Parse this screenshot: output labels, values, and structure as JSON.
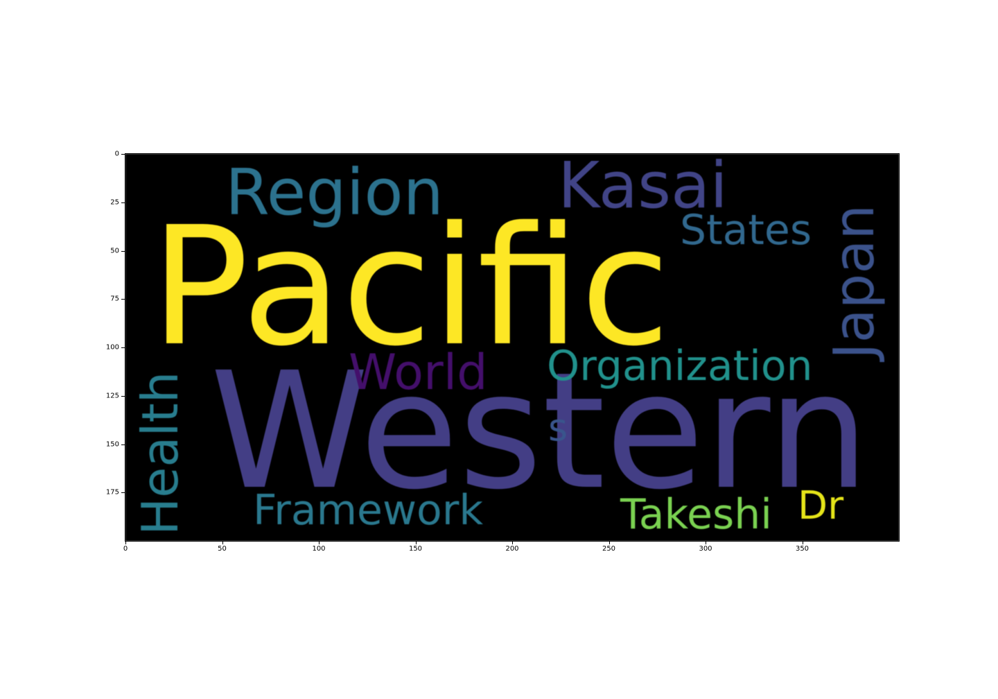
{
  "words": [
    {
      "text": "Pacific",
      "color": "#fde725"
    },
    {
      "text": "Western",
      "color": "#433e85"
    },
    {
      "text": "Region",
      "color": "#2c728e"
    },
    {
      "text": "Kasai",
      "color": "#414487"
    },
    {
      "text": "States",
      "color": "#31688e"
    },
    {
      "text": "Japan",
      "color": "#3b528b"
    },
    {
      "text": "World",
      "color": "#440f6b"
    },
    {
      "text": "Organization",
      "color": "#21918c"
    },
    {
      "text": "Health",
      "color": "#287d8e"
    },
    {
      "text": "s",
      "color": "#39558c"
    },
    {
      "text": "Framework",
      "color": "#2a788e"
    },
    {
      "text": "Takeshi",
      "color": "#7ad151"
    },
    {
      "text": "Dr",
      "color": "#e5e419"
    }
  ],
  "axes": {
    "x_ticks": [
      "0",
      "50",
      "100",
      "150",
      "200",
      "250",
      "300",
      "350"
    ],
    "y_ticks": [
      "0",
      "25",
      "50",
      "75",
      "100",
      "125",
      "150",
      "175"
    ]
  }
}
